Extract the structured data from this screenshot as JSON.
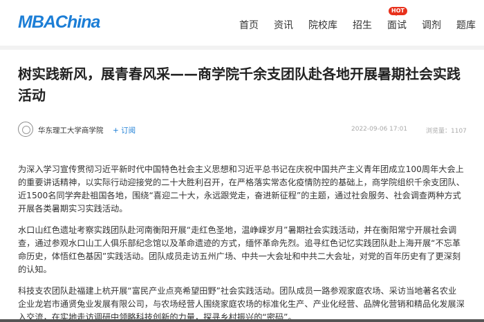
{
  "header": {
    "logo": "MBAChina",
    "nav": [
      {
        "label": "首页"
      },
      {
        "label": "资讯"
      },
      {
        "label": "院校库"
      },
      {
        "label": "招生"
      },
      {
        "label": "面试",
        "badge": "HOT"
      },
      {
        "label": "调剂"
      },
      {
        "label": "题库"
      }
    ]
  },
  "article": {
    "title": "树实践新风，展青春风采——商学院千余支团队赴各地开展暑期社会实践活动",
    "author": "华东理工大学商学院",
    "follow_label": "+ 订阅",
    "date": "2022-09-06 17:01",
    "views": "浏览量：1107",
    "paragraphs": [
      "为深入学习宣传贯彻习近平新时代中国特色社会主义思想和习近平总书记在庆祝中国共产主义青年团成立100周年大会上的重要讲话精神，以实际行动迎接党的二十大胜利召开，在严格落实常态化疫情防控的基础上，商学院组织千余支团队、近1500名同学奔赴祖国各地，围绕“喜迎二十大，永远跟党走，奋进新征程”的主题，通过社会服务、社会调查两种方式开展各类暑期实习实践活动。",
      "水口山红色遗址考察实践团队赴河南衡阳开展“走红色圣地，温峥嵘岁月”暑期社会实践活动，并在衡阳常宁开展社会调查，通过参观水口山工人俱乐部纪念馆以及革命遗迹的方式，缅怀革命先烈。追寻红色记忆实践团队赴上海开展“不忘革命历史，体悟红色基因”实践活动。团队成员走访五州广场、中共一大会址和中共二大会址，对党的百年历史有了更深刻的认知。",
      "科技支农团队赴福建上杭开展“富民产业点亮希望田野”社会实践活动。团队成员一路参观家庭农场、采访当地著名农业企业龙岩市通贤兔业发展有限公司，与农场经营人围绕家庭农场的标准化生产、产业化经营、品牌化营销和精品化发展深入交流，在实地走访调研中领略科技创新的力量，探寻乡村振兴的“密码”。"
    ]
  }
}
